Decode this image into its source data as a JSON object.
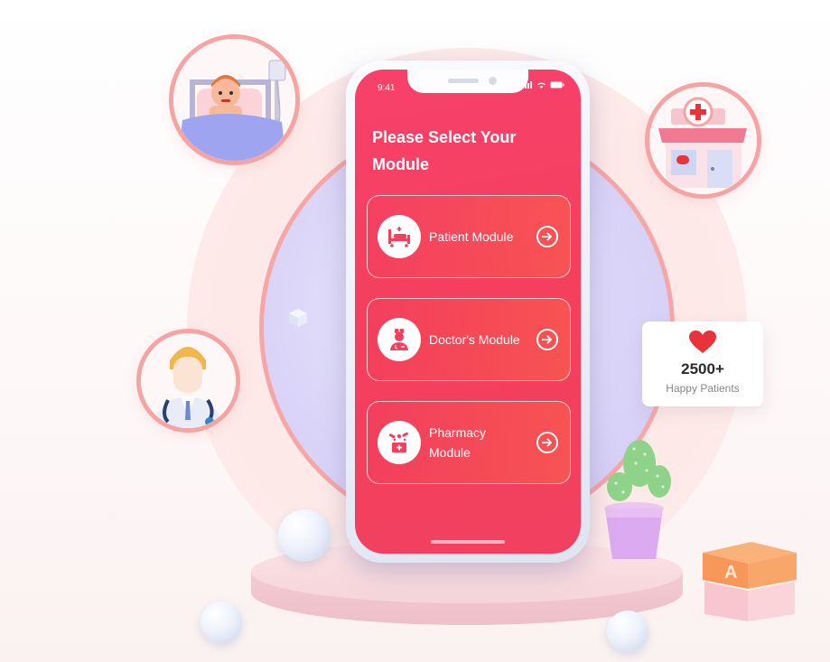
{
  "phone": {
    "status_time": "9:41",
    "title_line1": "Please Select Your",
    "title_line2": "Module",
    "modules": [
      {
        "label": "Patient Module",
        "icon": "hospital-bed-icon"
      },
      {
        "label": "Doctor's Module",
        "icon": "doctor-icon"
      },
      {
        "label_line1": "Pharmacy",
        "label_line2": "Module",
        "icon": "medicine-box-icon"
      }
    ],
    "arrow_icon": "arrow-right-icon"
  },
  "stats": {
    "value": "2500+",
    "label": "Happy Patients",
    "icon": "heart-icon"
  },
  "decor": {
    "avatars": [
      "patient-in-bed-illustration",
      "pharmacy-building-illustration",
      "doctor-illustration"
    ],
    "block_letter": "A"
  },
  "colors": {
    "screen": "#f43f5d",
    "ring": "#f5a3a3",
    "inner_circle": "#cfc8f5",
    "heart": "#e8333a"
  }
}
